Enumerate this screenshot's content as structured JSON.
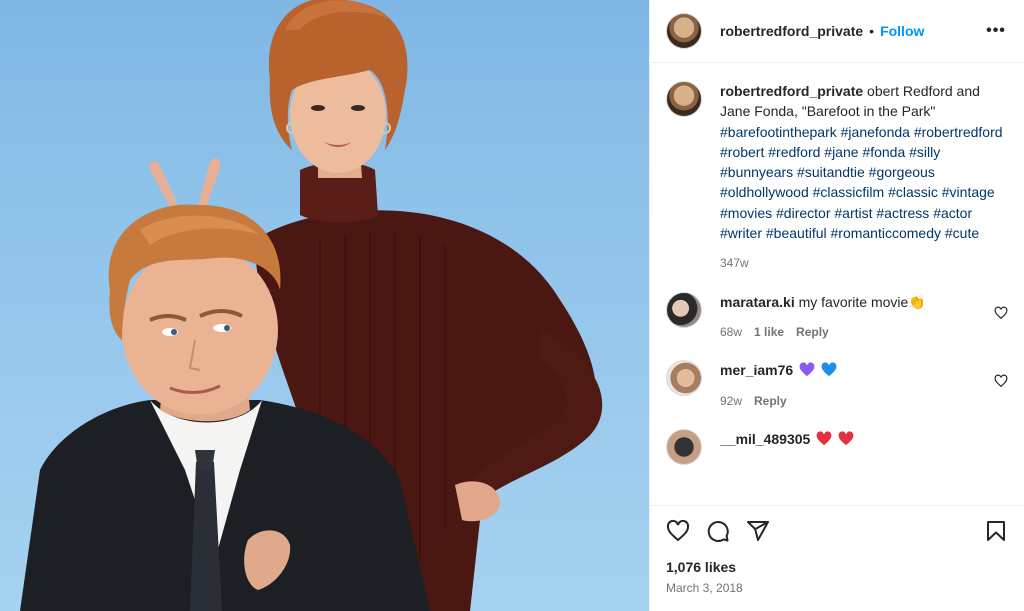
{
  "post": {
    "username": "robertredford_private",
    "separator": "•",
    "follow_label": "Follow",
    "more_label": "•••",
    "caption": {
      "username": "robertredford_private",
      "text": "obert Redford and Jane Fonda, \"Barefoot in the Park\"",
      "hashtags": "#barefootinthepark #janefonda #robertredford #robert #redford #jane #fonda #silly #bunnyears #suitandtie #gorgeous #oldhollywood #classicfilm #classic #vintage #movies #director #artist #actress #actor #writer #beautiful #romanticcomedy #cute",
      "time": "347w"
    },
    "comments": [
      {
        "username": "maratara.ki",
        "text": "my favorite movie👏",
        "time": "68w",
        "likes": "1 like",
        "reply": "Reply"
      },
      {
        "username": "mer_iam76",
        "text": "",
        "time": "92w",
        "reply": "Reply"
      },
      {
        "username": "__mil_489305",
        "text": ""
      }
    ],
    "likes": "1,076 likes",
    "date": "March 3, 2018"
  },
  "colors": {
    "accent": "#0095f6",
    "hashtag": "#00376b",
    "muted": "#737373",
    "purple_heart": "#8a5cf5",
    "blue_heart": "#1d8fe8",
    "red_heart": "#e0323f"
  },
  "icons": {
    "like": "heart-icon",
    "comment": "comment-bubble-icon",
    "share": "paper-plane-icon",
    "save": "bookmark-icon",
    "more": "ellipsis-icon"
  }
}
